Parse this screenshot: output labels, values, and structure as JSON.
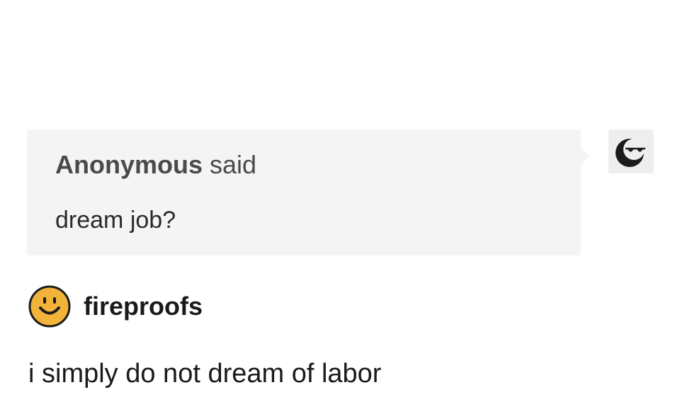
{
  "ask": {
    "asker_name": "Anonymous",
    "asker_verb": "said",
    "question": "dream job?",
    "avatar_icon": "anonymous-sunglasses-icon"
  },
  "answer": {
    "blog_name": "fireproofs",
    "avatar_icon": "smiley-face-icon",
    "text": "i simply do not dream of labor"
  },
  "colors": {
    "bubble_background": "#f4f4f4",
    "smiley_yellow": "#f2b33a"
  }
}
